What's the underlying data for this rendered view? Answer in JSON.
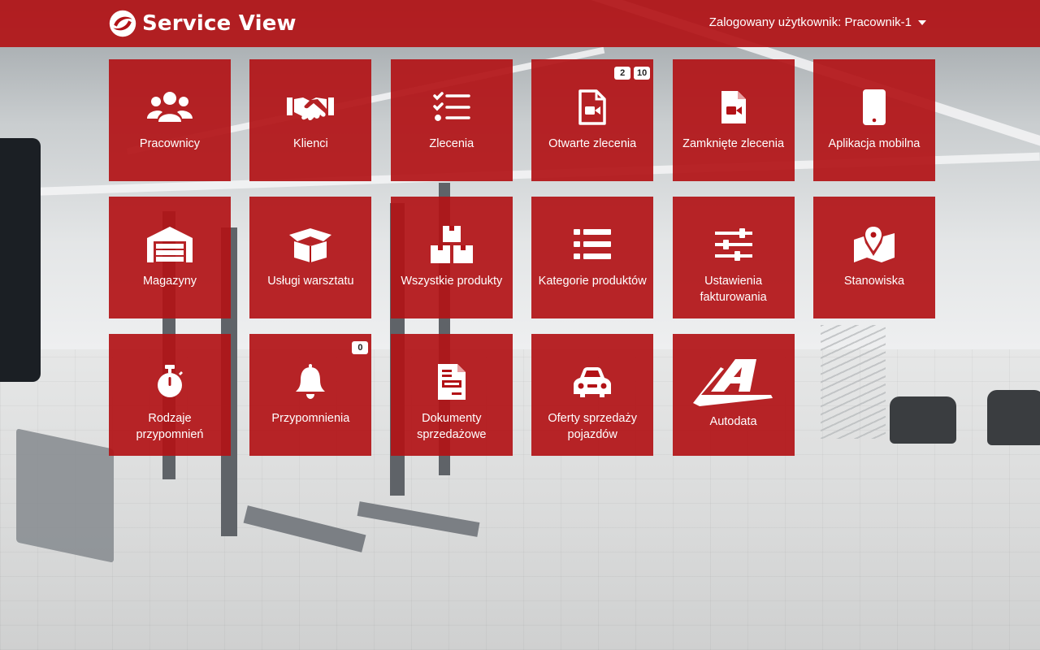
{
  "app": {
    "name": "Service View",
    "user_label": "Zalogowany użytkownik: Pracownik-1"
  },
  "tiles": [
    {
      "label": "Pracownicy",
      "icon": "users-icon"
    },
    {
      "label": "Klienci",
      "icon": "handshake-icon"
    },
    {
      "label": "Zlecenia",
      "icon": "checklist-icon"
    },
    {
      "label": "Otwarte zlecenia",
      "icon": "video-file-icon",
      "badges": [
        "2",
        "10"
      ]
    },
    {
      "label": "Zamknięte zlecenia",
      "icon": "video-file-icon"
    },
    {
      "label": "Aplikacja mobilna",
      "icon": "mobile-phone-icon"
    },
    {
      "label": "Magazyny",
      "icon": "warehouse-icon"
    },
    {
      "label": "Usługi warsztatu",
      "icon": "open-box-icon"
    },
    {
      "label": "Wszystkie produkty",
      "icon": "boxes-icon"
    },
    {
      "label": "Kategorie produktów",
      "icon": "list-icon"
    },
    {
      "label": "Ustawienia fakturowania",
      "icon": "sliders-icon"
    },
    {
      "label": "Stanowiska",
      "icon": "map-marker-icon"
    },
    {
      "label": "Rodzaje przypomnień",
      "icon": "stopwatch-icon"
    },
    {
      "label": "Przypomnienia",
      "icon": "bell-icon",
      "badges": [
        "0"
      ]
    },
    {
      "label": "Dokumenty sprzedażowe",
      "icon": "document-icon"
    },
    {
      "label": "Oferty sprzedaży pojazdów",
      "icon": "car-icon"
    },
    {
      "label": "Autodata",
      "icon": "autodata-logo-icon"
    }
  ],
  "colors": {
    "tile": "#b21216",
    "header": "#b21216",
    "text": "#ffffff"
  }
}
